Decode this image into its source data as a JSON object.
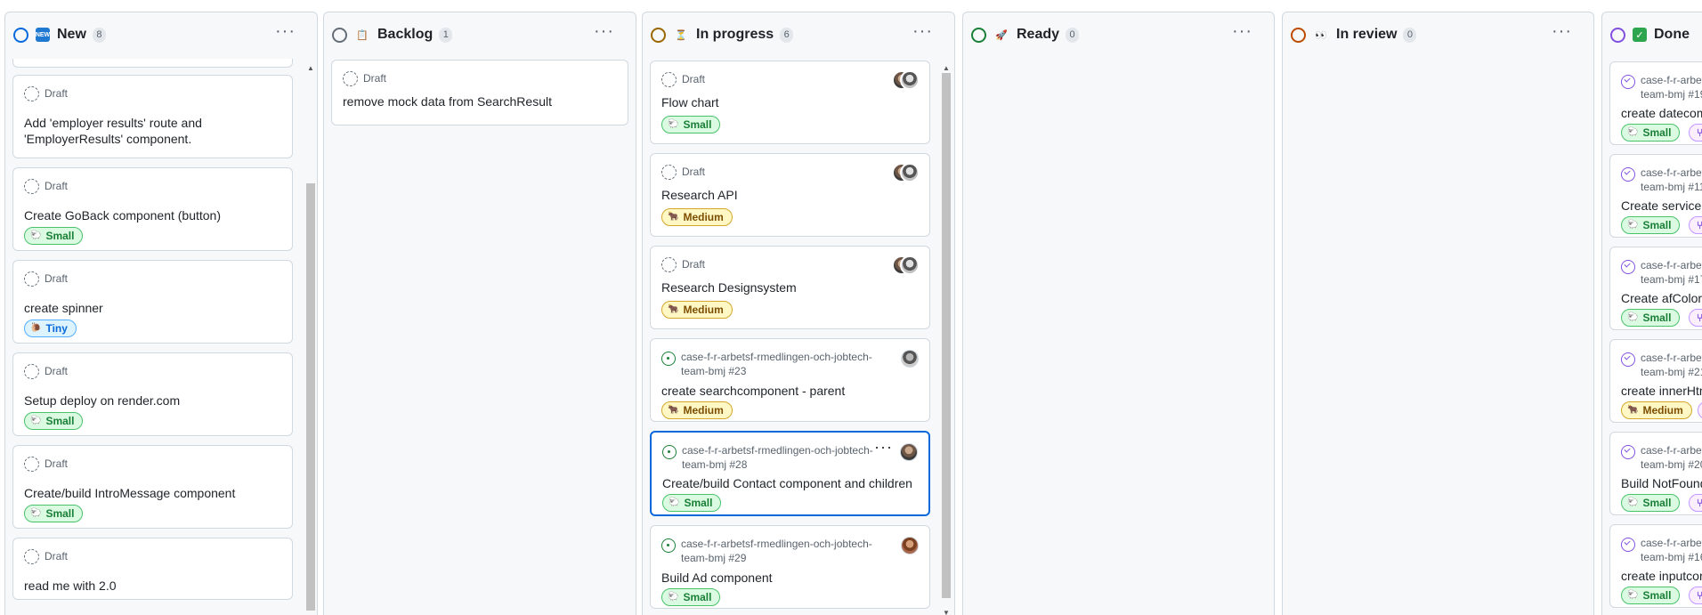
{
  "columns": [
    {
      "title": "New",
      "count": "8",
      "ring_color": "#0969da",
      "emoji": "new-button-icon",
      "cards": [
        {
          "meta": "Draft",
          "title_lines": [
            "Add 'employer results' route and",
            "'EmployerResults' component."
          ]
        },
        {
          "meta": "Draft",
          "title": "Create GoBack component (button)",
          "label": "Small"
        },
        {
          "meta": "Draft",
          "title": "create spinner",
          "label": "Tiny"
        },
        {
          "meta": "Draft",
          "title": "Setup deploy on render.com",
          "label": "Small"
        },
        {
          "meta": "Draft",
          "title": "Create/build IntroMessage component",
          "label": "Small"
        },
        {
          "meta": "Draft",
          "title": "read me with 2.0"
        }
      ]
    },
    {
      "title": "Backlog",
      "count": "1",
      "ring_color": "#656d76",
      "emoji": "clipboard-icon",
      "cards": [
        {
          "meta": "Draft",
          "title": "remove mock data from SearchResult"
        }
      ]
    },
    {
      "title": "In progress",
      "count": "6",
      "ring_color": "#9a6700",
      "emoji": "hourglass-icon",
      "cards": [
        {
          "meta": "Draft",
          "title": "Flow chart",
          "label": "Small"
        },
        {
          "meta": "Draft",
          "title": "Research API",
          "label": "Medium"
        },
        {
          "meta": "Draft",
          "title": "Research Designsystem",
          "label": "Medium"
        },
        {
          "meta_line1": "case-f-r-arbetsf-rmedlingen-och-jobtech-",
          "meta_line2": "team-bmj #23",
          "title": "create searchcomponent - parent",
          "label": "Medium"
        },
        {
          "meta_line1": "case-f-r-arbetsf-rmedlingen-och-jobtech-",
          "meta_line2": "team-bmj #28",
          "title": "Create/build Contact component and children",
          "label": "Small"
        },
        {
          "meta_line1": "case-f-r-arbetsf-rmedlingen-och-jobtech-",
          "meta_line2": "team-bmj #29",
          "title": "Build Ad component",
          "label": "Small"
        }
      ]
    },
    {
      "title": "Ready",
      "count": "0",
      "ring_color": "#1a7f37",
      "emoji": "rocket-icon",
      "cards": []
    },
    {
      "title": "In review",
      "count": "0",
      "ring_color": "#bc4c00",
      "emoji": "eyes-icon",
      "cards": []
    },
    {
      "title": "Done",
      "ring_color": "#8250df",
      "emoji": "check-mark-icon",
      "cards": [
        {
          "meta_line1": "case-f-r-arbet",
          "meta_line2": "team-bmj #19",
          "title": "create datecom",
          "label": "Small"
        },
        {
          "meta_line1": "case-f-r-arbet",
          "meta_line2": "team-bmj #11",
          "title": "Create service",
          "label": "Small"
        },
        {
          "meta_line1": "case-f-r-arbet",
          "meta_line2": "team-bmj #17",
          "title": "Create afColorF",
          "label": "Small"
        },
        {
          "meta_line1": "case-f-r-arbet",
          "meta_line2": "team-bmj #21",
          "title": "create innerHtm",
          "label": "Medium"
        },
        {
          "meta_line1": "case-f-r-arbet",
          "meta_line2": "team-bmj #20",
          "title": "Build NotFound",
          "label": "Small"
        },
        {
          "meta_line1": "case-f-r-arbet",
          "meta_line2": "team-bmj #16",
          "title": "create inputcor",
          "label": "Small"
        }
      ]
    }
  ],
  "icons": {
    "column_menu": "more-horizontal-icon",
    "card_menu": "more-horizontal-icon",
    "scroll_up": "scroll-up-arrow-icon",
    "scroll_down": "scroll-down-arrow-icon"
  },
  "colors": {
    "selected_border": "#0969da",
    "label_small": "#1a7f37",
    "label_medium": "#7d4e00",
    "label_tiny": "#0969da"
  }
}
